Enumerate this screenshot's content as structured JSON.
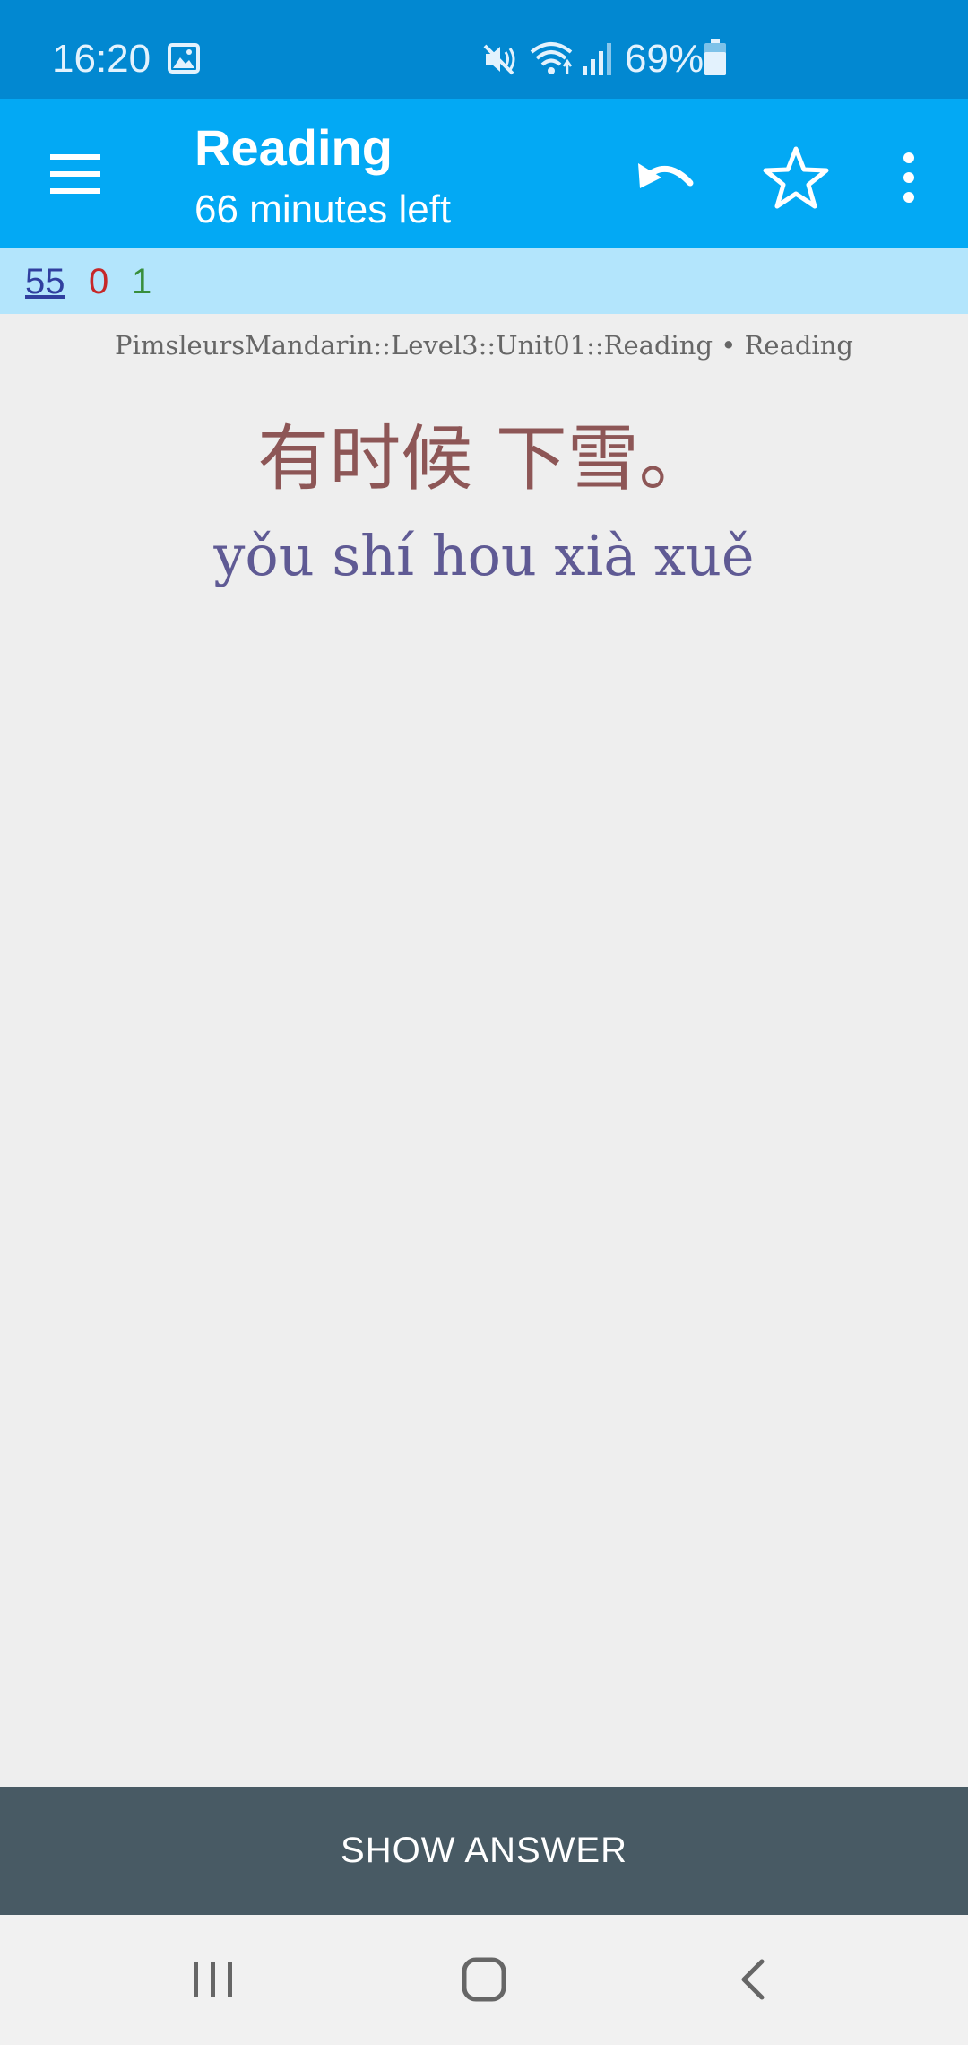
{
  "status_bar": {
    "time": "16:20",
    "battery": "69%"
  },
  "app_bar": {
    "title": "Reading",
    "subtitle": "66 minutes left"
  },
  "counts": {
    "new": "55",
    "learning": "0",
    "review": "1"
  },
  "card": {
    "deck_path": "PimsleursMandarin::Level3::Unit01::Reading • Reading",
    "hanzi": "有时候   下雪。",
    "pinyin": "yǒu shí hou xià xuě"
  },
  "show_answer_label": "SHOW ANSWER",
  "colors": {
    "status_bar": "#0288d1",
    "app_bar": "#03a9f4",
    "counts_bar": "#b3e5fc",
    "background": "#eeeeee",
    "hanzi": "#8d5656",
    "pinyin": "#5f5a94",
    "button": "#485a64"
  },
  "icons": [
    "gallery-icon",
    "mute-icon",
    "wifi-icon",
    "signal-icon",
    "battery-icon",
    "menu-icon",
    "undo-icon",
    "star-icon",
    "more-vert-icon",
    "recents-icon",
    "home-icon",
    "back-icon"
  ]
}
